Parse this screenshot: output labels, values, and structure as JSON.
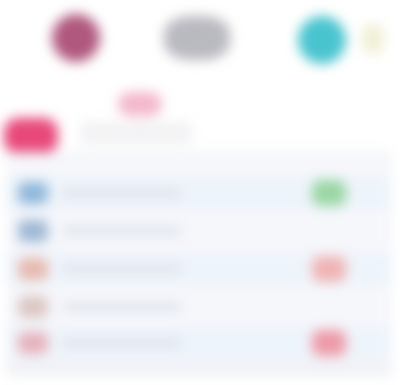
{
  "header": {
    "icons": [
      {
        "name": "app-icon-magenta",
        "color": "#b0587e"
      },
      {
        "name": "app-icon-gray",
        "color": "#b9b9c0"
      },
      {
        "name": "app-icon-teal",
        "color": "#49c4cf"
      },
      {
        "name": "app-icon-cream",
        "color": "#f1efd6"
      }
    ]
  },
  "tabs": [
    {
      "name": "tab-active",
      "color": "#e8487a"
    },
    {
      "name": "tab-secondary",
      "color": "#f2f2f4"
    }
  ],
  "list": {
    "rows": [
      {
        "icon_color": "#8fb7da",
        "status_color": "#9ad6a4"
      },
      {
        "icon_color": "#9fb8d4"
      },
      {
        "icon_color": "#e7b9b0",
        "status_color": "#f0b4b4"
      },
      {
        "icon_color": "#dcc7c4"
      },
      {
        "icon_color": "#e7b2bc",
        "status_color": "#ee9aa7"
      }
    ]
  }
}
